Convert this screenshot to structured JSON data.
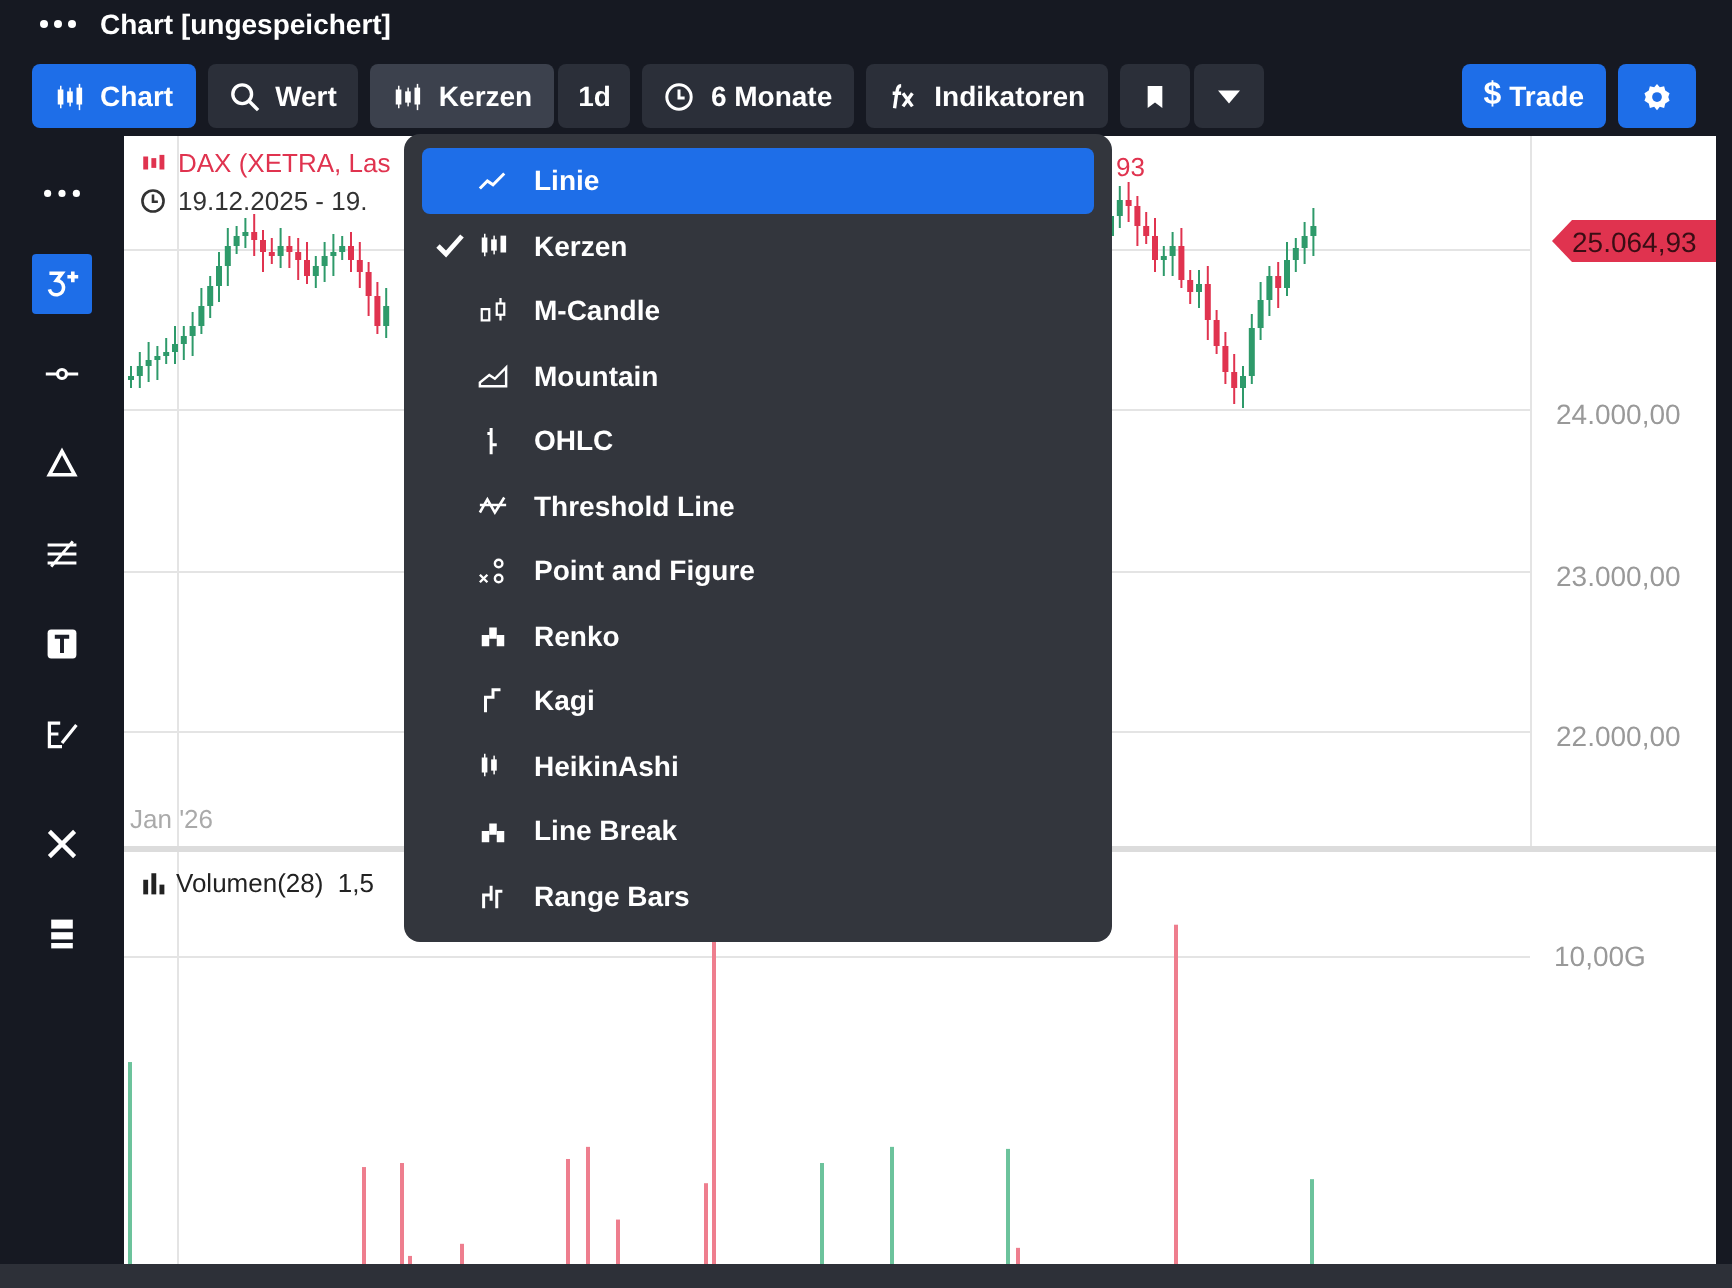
{
  "window": {
    "title": "Chart [ungespeichert]"
  },
  "toolbar": {
    "buttons": [
      {
        "kind": "chart",
        "label": "Chart"
      },
      {
        "kind": "search",
        "label": "Wert"
      },
      {
        "kind": "candles",
        "label": "Kerzen",
        "open": true,
        "suffix": "1d"
      },
      {
        "kind": "clock",
        "label": "6 Monate"
      },
      {
        "kind": "fx",
        "label": "Indikatoren"
      },
      {
        "kind": "bookmark"
      }
    ],
    "trade": {
      "label": "Trade",
      "symbol": "$"
    }
  },
  "sidebar": {
    "items": [
      {
        "kind": "more",
        "selected": false
      },
      {
        "kind": "plus",
        "selected": true
      },
      {
        "kind": "line",
        "selected": false
      },
      {
        "kind": "triangle",
        "selected": false
      },
      {
        "kind": "fib",
        "selected": false
      },
      {
        "kind": "text",
        "selected": false
      },
      {
        "kind": "pen",
        "selected": false
      },
      {
        "kind": "tools",
        "selected": false
      },
      {
        "kind": "layout",
        "selected": false
      }
    ]
  },
  "chart": {
    "instrument": "DAX (XETRA, Las",
    "instrument_tail": "93",
    "range": "19.12.2025 - 19.",
    "last_price": "25.064,93",
    "price_axis": [
      "24.000,00",
      "23.000,00",
      "22.000,00"
    ],
    "time_label": "Jan '26",
    "volume": {
      "label": "Volumen(28)  1,5",
      "axis": [
        "10,00G"
      ]
    }
  },
  "chart_type_menu": {
    "items": [
      {
        "kind": "line",
        "label": "Linie",
        "highlighted": true,
        "checked": false
      },
      {
        "kind": "candles",
        "label": "Kerzen",
        "highlighted": false,
        "checked": true
      },
      {
        "kind": "mcandle",
        "label": "M-Candle",
        "highlighted": false,
        "checked": false
      },
      {
        "kind": "mountain",
        "label": "Mountain",
        "highlighted": false,
        "checked": false
      },
      {
        "kind": "ohlc",
        "label": "OHLC",
        "highlighted": false,
        "checked": false
      },
      {
        "kind": "threshold",
        "label": "Threshold Line",
        "highlighted": false,
        "checked": false
      },
      {
        "kind": "pnf",
        "label": "Point and Figure",
        "highlighted": false,
        "checked": false
      },
      {
        "kind": "renko",
        "label": "Renko",
        "highlighted": false,
        "checked": false
      },
      {
        "kind": "kagi",
        "label": "Kagi",
        "highlighted": false,
        "checked": false
      },
      {
        "kind": "heikin",
        "label": "HeikinAshi",
        "highlighted": false,
        "checked": false
      },
      {
        "kind": "linebreak",
        "label": "Line Break",
        "highlighted": false,
        "checked": false
      },
      {
        "kind": "rangebars",
        "label": "Range Bars",
        "highlighted": false,
        "checked": false
      }
    ]
  }
}
